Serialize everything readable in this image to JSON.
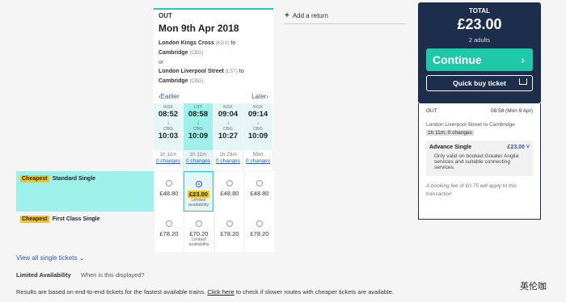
{
  "outbound": {
    "label": "OUT",
    "date": "Mon 9th Apr 2018",
    "route1_from": "London Kings Cross",
    "route1_from_code": "(KGX)",
    "to_word": "to",
    "route1_to": "Cambridge",
    "route1_to_code": "(CBG)",
    "or_word": "or",
    "route2_from": "London Liverpool Street",
    "route2_from_code": "(LST)",
    "route2_to": "Cambridge",
    "route2_to_code": "(CBG)",
    "earlier_label": "Earlier",
    "later_label": "Later"
  },
  "trains": [
    {
      "from_code": "KGX",
      "depart": "08:52",
      "arrow": "↓",
      "to_code": "CBG",
      "arrive": "10:03",
      "duration": "1h 11m",
      "changes": "0 changes"
    },
    {
      "from_code": "LST",
      "depart": "08:58",
      "arrow": "↓",
      "to_code": "CBG",
      "arrive": "10:09",
      "duration": "1h 11m",
      "changes": "0 changes"
    },
    {
      "from_code": "KGX",
      "depart": "09:04",
      "arrow": "↓",
      "to_code": "CBG",
      "arrive": "10:27",
      "duration": "1h 23m",
      "changes": "0 changes"
    },
    {
      "from_code": "KGX",
      "depart": "09:14",
      "arrow": "↓",
      "to_code": "CBG",
      "arrive": "10:09",
      "duration": "55m",
      "changes": "0 changes"
    }
  ],
  "add_return": {
    "icon": "plus-icon",
    "label": "Add a return"
  },
  "ticket_rows": [
    {
      "badge": "Cheapest",
      "name": "Standard Single",
      "prices": [
        "£48.80",
        "£23.00",
        "£48.80",
        "£48.80"
      ],
      "limited": [
        "",
        "Limited availability",
        "",
        ""
      ]
    },
    {
      "badge": "Cheapest",
      "name": "First Class Single",
      "prices": [
        "£78.20",
        "£70.20",
        "£78.20",
        "£78.20"
      ],
      "limited": [
        "",
        "Limited availability",
        "",
        ""
      ]
    }
  ],
  "view_all": "View all single tickets",
  "limited_availability": {
    "title": "Limited Availability",
    "question": "When is this displayed?"
  },
  "results_note": {
    "before": "Results are based on end-to-end tickets for the fastest available trains. ",
    "link": "Click here",
    "after": " to check if slower routes with cheaper tickets are available."
  },
  "total": {
    "label": "TOTAL",
    "amount": "£23.00",
    "passengers": "2 adults",
    "continue_label": "Continue",
    "quick_buy_label": "Quick buy ticket"
  },
  "summary": {
    "direction": "OUT",
    "time_date": "08:58 (Mon 9 Apr)",
    "route": "London Liverpool Street to Cambridge",
    "duration": "1h 11m, 0 changes",
    "ticket_name": "Advance Single",
    "ticket_price": "£23.00",
    "ticket_note": "Only valid on booked Greater Anglia services and suitable connecting services.",
    "fee_note": "A booking fee of £0.75 will apply to this transaction"
  },
  "watermark": "英伦咖",
  "colors": {
    "accent": "#1fc8a9",
    "highlight": "#f7c417",
    "panel": "#1d2e4d",
    "selected_bg": "#9ef1ea",
    "link": "#2a5db0"
  }
}
